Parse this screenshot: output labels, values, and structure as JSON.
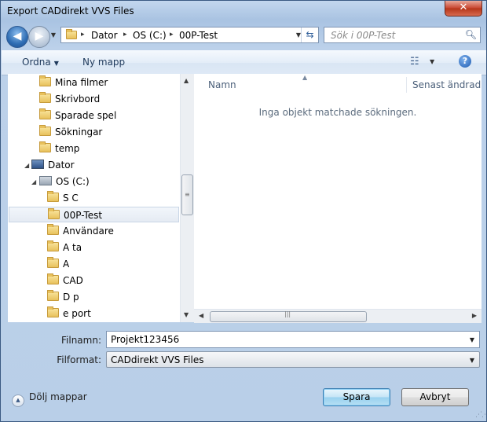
{
  "window": {
    "title": "Export CADdirekt VVS Files",
    "close_glyph": "✕"
  },
  "nav": {
    "back_glyph": "◀",
    "forward_glyph": "▶"
  },
  "address": {
    "segments": [
      "Dator",
      "OS (C:)",
      "00P-Test"
    ],
    "separator": "▸"
  },
  "search": {
    "placeholder": "Sök i 00P-Test"
  },
  "toolbar": {
    "organize": "Ordna",
    "new_folder": "Ny mapp",
    "help": "?"
  },
  "tree": [
    {
      "label": "Mina filmer",
      "type": "folder"
    },
    {
      "label": "Skrivbord",
      "type": "folder"
    },
    {
      "label": "Sparade spel",
      "type": "folder"
    },
    {
      "label": "Sökningar",
      "type": "folder"
    },
    {
      "label": "temp",
      "type": "folder"
    },
    {
      "label": "Dator",
      "type": "computer"
    },
    {
      "label": "OS (C:)",
      "type": "drive"
    },
    {
      "label": "S  C",
      "type": "folder"
    },
    {
      "label": "00P-Test",
      "type": "folder",
      "selected": true
    },
    {
      "label": "Användare",
      "type": "folder"
    },
    {
      "label": "A      ta",
      "type": "folder"
    },
    {
      "label": "A",
      "type": "folder"
    },
    {
      "label": "CAD",
      "type": "folder"
    },
    {
      "label": "D    p",
      "type": "folder"
    },
    {
      "label": "e   port",
      "type": "folder"
    }
  ],
  "columns": {
    "name": "Namn",
    "modified": "Senast ändrad"
  },
  "empty_message": "Inga objekt matchade sökningen.",
  "form": {
    "filename_label": "Filnamn:",
    "filename_value": "Projekt123456",
    "format_label": "Filformat:",
    "format_value": "CADdirekt VVS Files"
  },
  "footer": {
    "hide_folders": "Dölj mappar",
    "save": "Spara",
    "cancel": "Avbryt"
  }
}
